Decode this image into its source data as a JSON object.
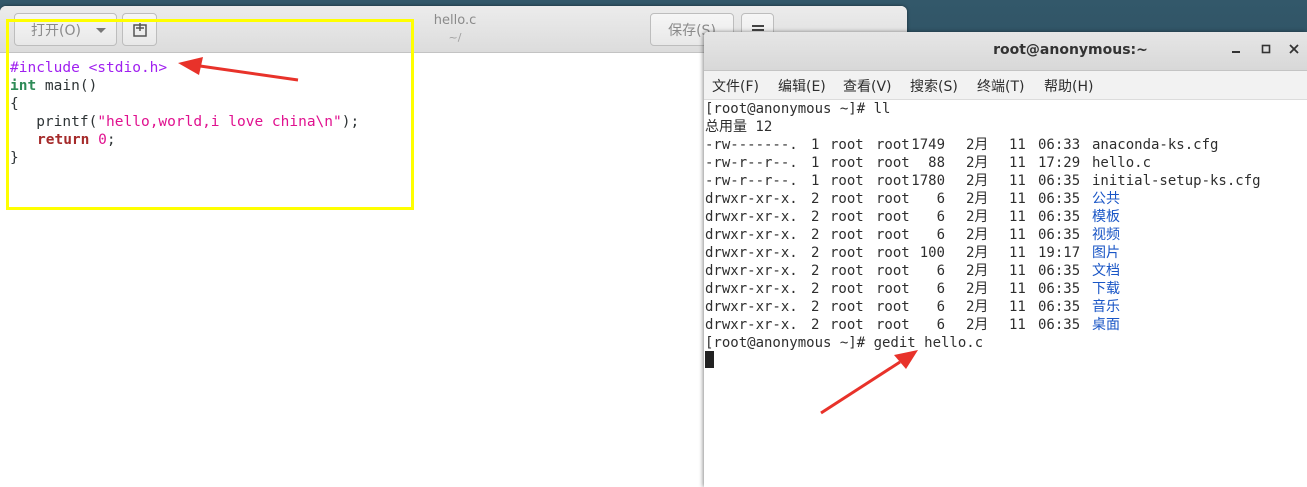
{
  "gedit": {
    "open_label": "打开(O)",
    "save_label": "保存(S)",
    "title": "hello.c",
    "subtitle": "~/",
    "code": {
      "line1": "#include <stdio.h>",
      "line2_type": "int",
      "line2_rest": " main()",
      "line3": "{",
      "line4_pre": "   printf(",
      "line4_str": "\"hello,world,i love china\\n\"",
      "line4_post": ");",
      "line5_kw": "return",
      "line5_sp": " ",
      "line5_num": "0",
      "line5_post": ";",
      "line6": "}"
    }
  },
  "terminal": {
    "title": "root@anonymous:~",
    "menu": [
      "文件(F)",
      "编辑(E)",
      "查看(V)",
      "搜索(S)",
      "终端(T)",
      "帮助(H)"
    ],
    "prompt1": "[root@anonymous ~]# ll",
    "total": "总用量 12",
    "rows": [
      {
        "perm": "-rw-------.",
        "links": "1",
        "user": "root",
        "group": "root",
        "size": "1749",
        "month": "2月",
        "day": "11",
        "time": "06:33",
        "name": "anaconda-ks.cfg",
        "dir": false
      },
      {
        "perm": "-rw-r--r--.",
        "links": "1",
        "user": "root",
        "group": "root",
        "size": "88",
        "month": "2月",
        "day": "11",
        "time": "17:29",
        "name": "hello.c",
        "dir": false
      },
      {
        "perm": "-rw-r--r--.",
        "links": "1",
        "user": "root",
        "group": "root",
        "size": "1780",
        "month": "2月",
        "day": "11",
        "time": "06:35",
        "name": "initial-setup-ks.cfg",
        "dir": false
      },
      {
        "perm": "drwxr-xr-x.",
        "links": "2",
        "user": "root",
        "group": "root",
        "size": "6",
        "month": "2月",
        "day": "11",
        "time": "06:35",
        "name": "公共",
        "dir": true
      },
      {
        "perm": "drwxr-xr-x.",
        "links": "2",
        "user": "root",
        "group": "root",
        "size": "6",
        "month": "2月",
        "day": "11",
        "time": "06:35",
        "name": "模板",
        "dir": true
      },
      {
        "perm": "drwxr-xr-x.",
        "links": "2",
        "user": "root",
        "group": "root",
        "size": "6",
        "month": "2月",
        "day": "11",
        "time": "06:35",
        "name": "视频",
        "dir": true
      },
      {
        "perm": "drwxr-xr-x.",
        "links": "2",
        "user": "root",
        "group": "root",
        "size": "100",
        "month": "2月",
        "day": "11",
        "time": "19:17",
        "name": "图片",
        "dir": true
      },
      {
        "perm": "drwxr-xr-x.",
        "links": "2",
        "user": "root",
        "group": "root",
        "size": "6",
        "month": "2月",
        "day": "11",
        "time": "06:35",
        "name": "文档",
        "dir": true
      },
      {
        "perm": "drwxr-xr-x.",
        "links": "2",
        "user": "root",
        "group": "root",
        "size": "6",
        "month": "2月",
        "day": "11",
        "time": "06:35",
        "name": "下载",
        "dir": true
      },
      {
        "perm": "drwxr-xr-x.",
        "links": "2",
        "user": "root",
        "group": "root",
        "size": "6",
        "month": "2月",
        "day": "11",
        "time": "06:35",
        "name": "音乐",
        "dir": true
      },
      {
        "perm": "drwxr-xr-x.",
        "links": "2",
        "user": "root",
        "group": "root",
        "size": "6",
        "month": "2月",
        "day": "11",
        "time": "06:35",
        "name": "桌面",
        "dir": true
      }
    ],
    "prompt2": "[root@anonymous ~]# gedit hello.c"
  },
  "colors": {
    "highlight": "#ffff00",
    "annotation_arrow": "#e8322a",
    "directory": "#1a56c6"
  }
}
